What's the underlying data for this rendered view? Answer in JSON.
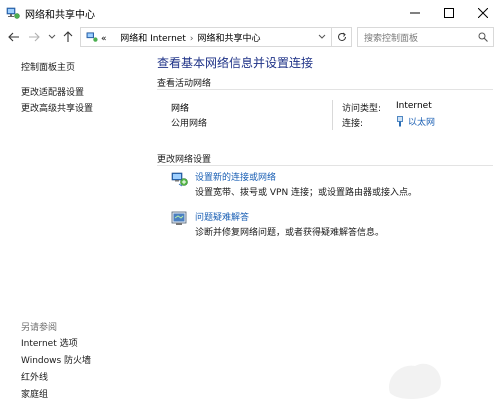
{
  "window": {
    "title": "网络和共享中心"
  },
  "address_bar": {
    "overflow": "«",
    "crumbs": [
      "网络和 Internet",
      "网络和共享中心"
    ]
  },
  "search": {
    "placeholder": "搜索控制面板"
  },
  "sidebar": {
    "links": [
      "控制面板主页",
      "更改适配器设置",
      "更改高级共享设置"
    ],
    "see_also_heading": "另请参阅",
    "see_also": [
      "Internet 选项",
      "Windows 防火墙",
      "红外线",
      "家庭组"
    ]
  },
  "main": {
    "title": "查看基本网络信息并设置连接",
    "active_networks_label": "查看活动网络",
    "network": {
      "name": "网络",
      "type": "公用网络",
      "access_type_label": "访问类型:",
      "access_type_value": "Internet",
      "connections_label": "连接:",
      "connection_value": "以太网"
    },
    "change_settings_label": "更改网络设置",
    "tasks": [
      {
        "link": "设置新的连接或网络",
        "desc": "设置宽带、拨号或 VPN 连接；或设置路由器或接入点。"
      },
      {
        "link": "问题疑难解答",
        "desc": "诊断并修复网络问题，或者获得疑难解答信息。"
      }
    ]
  },
  "icons": {
    "app": "network-sharing-icon",
    "minimize": "minimize-icon",
    "maximize": "maximize-icon",
    "close": "close-icon",
    "back": "back-arrow-icon",
    "forward": "forward-arrow-icon",
    "recent": "chevron-down-icon",
    "up": "up-arrow-icon",
    "refresh": "refresh-icon",
    "search": "search-icon",
    "ethernet": "ethernet-plug-icon",
    "new_connection": "new-connection-icon",
    "troubleshoot": "troubleshoot-icon"
  },
  "colors": {
    "link": "#1a5fb4",
    "title": "#1e3287",
    "sidebar_link": "#1a3e8c"
  }
}
